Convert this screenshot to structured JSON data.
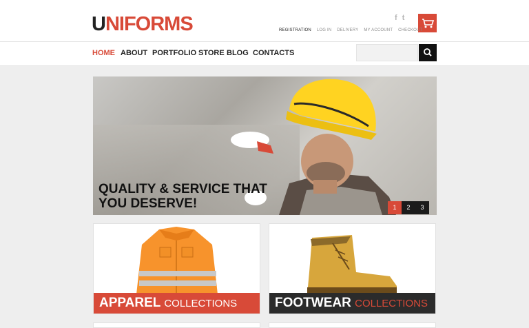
{
  "header": {
    "logo_first": "U",
    "logo_rest": "NIFORMS",
    "social": [
      "f",
      "t"
    ],
    "cart_icon": "cart-icon",
    "top_links": [
      "REGISTRATION",
      "LOG IN",
      "DELIVERY",
      "MY ACCOUNT",
      "CHECKOUT"
    ]
  },
  "nav": {
    "items": [
      "HOME",
      "ABOUT",
      "PORTFOLIO",
      "STORE",
      "BLOG",
      "CONTACTS"
    ],
    "active": "HOME"
  },
  "search": {
    "placeholder": "",
    "button_icon": "search-icon"
  },
  "hero": {
    "title_line1": "QUALITY & SERVICE THAT",
    "title_line2": "YOU DESERVE!",
    "slides": [
      "1",
      "2",
      "3"
    ],
    "active_slide": "1"
  },
  "cards": [
    {
      "title": "APPAREL",
      "subtitle": "COLLECTIONS"
    },
    {
      "title": "FOOTWEAR",
      "subtitle": "COLLECTIONS"
    }
  ],
  "colors": {
    "accent": "#d84a38",
    "dark": "#222222",
    "background": "#eeeeee"
  }
}
